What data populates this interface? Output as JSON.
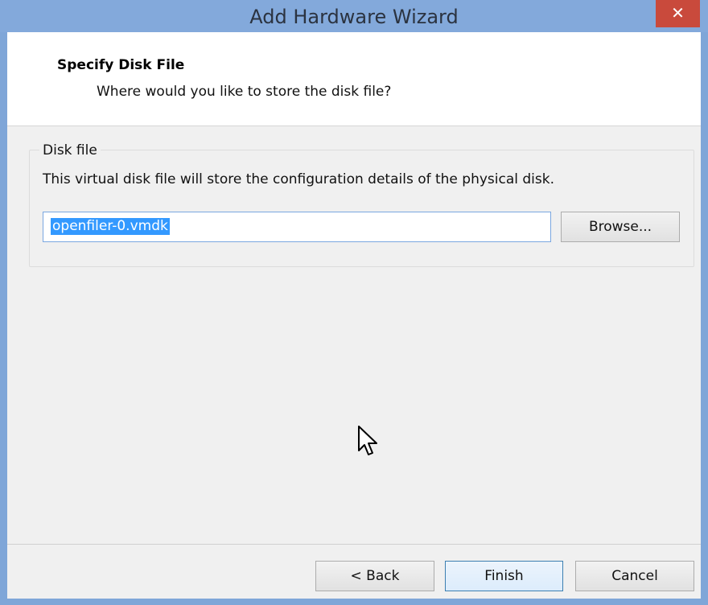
{
  "window": {
    "title": "Add Hardware Wizard",
    "close_glyph": "✕"
  },
  "header": {
    "title": "Specify Disk File",
    "subtitle": "Where would you like to store the disk file?"
  },
  "disk_group": {
    "label": "Disk file",
    "description": "This virtual disk file will store the configuration details of the physical disk.",
    "file_value": "openfiler-0.vmdk",
    "browse_label": "Browse..."
  },
  "footer": {
    "back_label": "< Back",
    "finish_label": "Finish",
    "cancel_label": "Cancel"
  },
  "icons": {
    "close": "close-icon",
    "cursor": "mouse-pointer-icon"
  }
}
